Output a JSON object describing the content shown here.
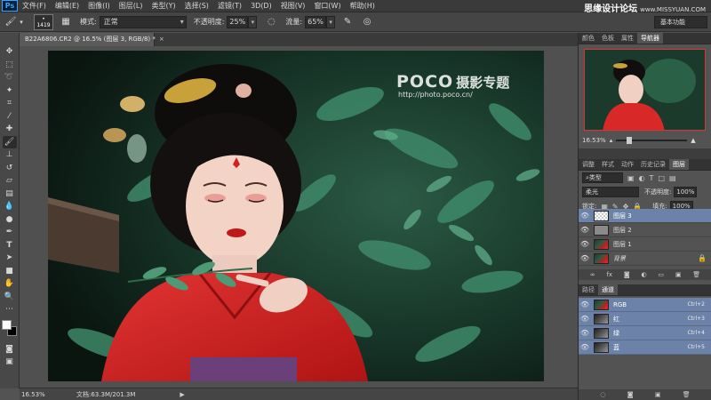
{
  "app": {
    "logo": "Ps",
    "brand_cn": "思缘设计论坛",
    "brand_site": "www.MISSYUAN.COM"
  },
  "menu": [
    "文件(F)",
    "编辑(E)",
    "图像(I)",
    "图层(L)",
    "类型(Y)",
    "选择(S)",
    "滤镜(T)",
    "3D(D)",
    "视图(V)",
    "窗口(W)",
    "帮助(H)"
  ],
  "options": {
    "brush_size": "1419",
    "mode_label": "模式:",
    "mode_value": "正常",
    "opacity_label": "不透明度:",
    "opacity_value": "25%",
    "flow_label": "流量:",
    "flow_value": "65%",
    "workspace": "基本功能"
  },
  "document": {
    "tab_title": "B22A6806.CR2 @ 16.5% (图层 3, RGB/8) *",
    "tab_close": "×",
    "zoom": "16.53%",
    "doc_size": "文档:63.3M/201.3M",
    "watermark_logo": "POCO",
    "watermark_cn": "摄影专题",
    "watermark_url": "http://photo.poco.cn/"
  },
  "panels": {
    "top_tabs": [
      "颜色",
      "色板",
      "属性",
      "导航器"
    ],
    "nav_zoom": "16.53%",
    "layer_tabs": [
      "调整",
      "样式",
      "动作",
      "历史记录",
      "图层"
    ],
    "filter_label": "类型",
    "blend_mode": "柔光",
    "opacity_label": "不透明度:",
    "opacity_value": "100%",
    "lock_label": "锁定:",
    "fill_label": "填充:",
    "fill_value": "100%",
    "layers": [
      {
        "name": "图层 3",
        "thumb": "checker"
      },
      {
        "name": "图层 2",
        "thumb": "gray"
      },
      {
        "name": "图层 1",
        "thumb": "photo"
      },
      {
        "name": "背景",
        "thumb": "photo"
      }
    ],
    "channel_tabs": [
      "路径",
      "通道"
    ],
    "channels": [
      {
        "name": "RGB",
        "key": "Ctrl+2"
      },
      {
        "name": "红",
        "key": "Ctrl+3"
      },
      {
        "name": "绿",
        "key": "Ctrl+4"
      },
      {
        "name": "蓝",
        "key": "Ctrl+5"
      }
    ]
  },
  "colors": {
    "accent": "#6d82a8",
    "ui_bg": "#535353",
    "foreground": "#ffffff",
    "background": "#000000"
  }
}
